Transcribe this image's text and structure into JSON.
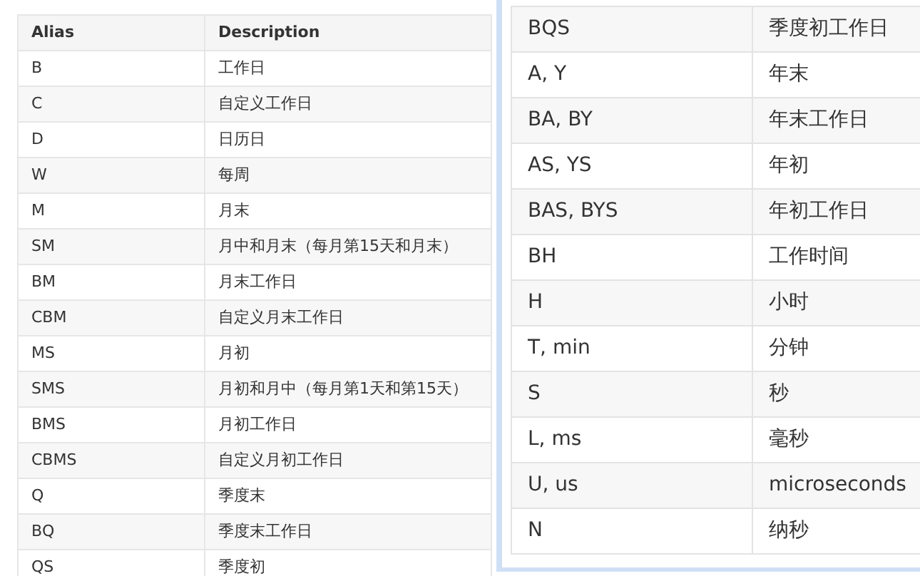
{
  "left_table": {
    "columns": [
      "Alias",
      "Description"
    ],
    "rows": [
      {
        "alias": "B",
        "description": "工作日"
      },
      {
        "alias": "C",
        "description": "自定义工作日"
      },
      {
        "alias": "D",
        "description": "日历日"
      },
      {
        "alias": "W",
        "description": "每周"
      },
      {
        "alias": "M",
        "description": "月末"
      },
      {
        "alias": "SM",
        "description": "月中和月末（每月第15天和月末）"
      },
      {
        "alias": "BM",
        "description": "月末工作日"
      },
      {
        "alias": "CBM",
        "description": "自定义月末工作日"
      },
      {
        "alias": "MS",
        "description": "月初"
      },
      {
        "alias": "SMS",
        "description": "月初和月中（每月第1天和第15天）"
      },
      {
        "alias": "BMS",
        "description": "月初工作日"
      },
      {
        "alias": "CBMS",
        "description": "自定义月初工作日"
      },
      {
        "alias": "Q",
        "description": "季度末"
      },
      {
        "alias": "BQ",
        "description": "季度末工作日"
      },
      {
        "alias": "QS",
        "description": "季度初"
      }
    ]
  },
  "right_table": {
    "rows": [
      {
        "alias": "BQS",
        "description": "季度初工作日"
      },
      {
        "alias": "A, Y",
        "description": "年末"
      },
      {
        "alias": "BA, BY",
        "description": "年末工作日"
      },
      {
        "alias": "AS, YS",
        "description": "年初"
      },
      {
        "alias": "BAS, BYS",
        "description": "年初工作日"
      },
      {
        "alias": "BH",
        "description": "工作时间"
      },
      {
        "alias": "H",
        "description": "小时"
      },
      {
        "alias": "T, min",
        "description": "分钟"
      },
      {
        "alias": "S",
        "description": "秒"
      },
      {
        "alias": "L, ms",
        "description": "毫秒"
      },
      {
        "alias": "U, us",
        "description": "microseconds"
      },
      {
        "alias": "N",
        "description": "纳秒"
      }
    ]
  }
}
